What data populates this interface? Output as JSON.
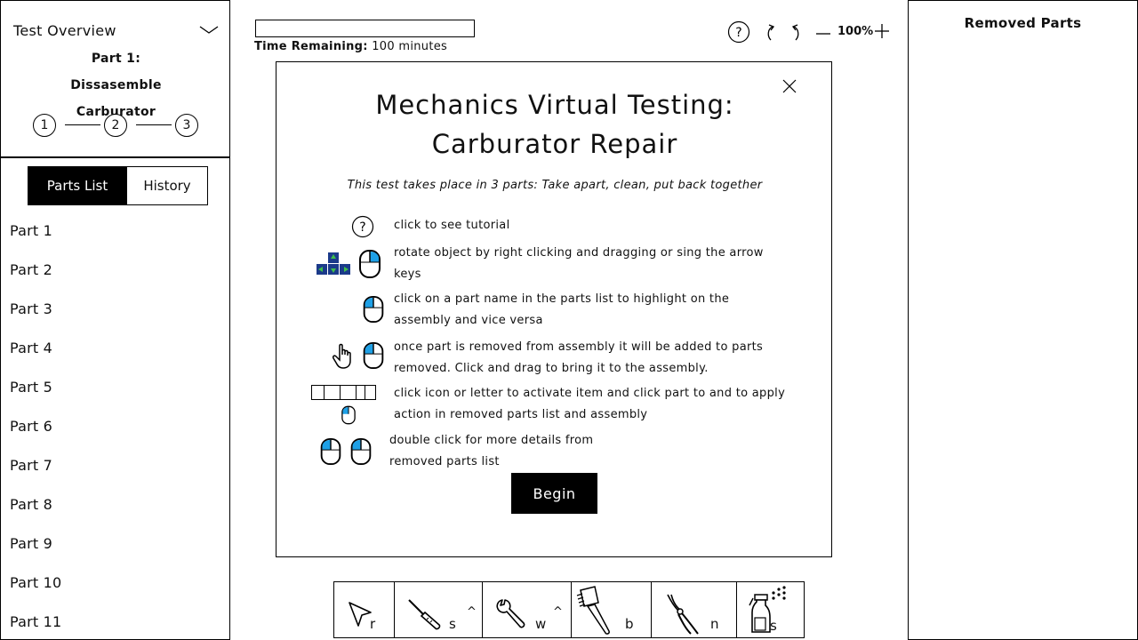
{
  "left_panel": {
    "overview_title": "Test Overview",
    "part_title": "Part 1: Dissasemble Carburator",
    "steps": [
      "1",
      "2",
      "3"
    ],
    "tabs": {
      "parts_list": "Parts List",
      "history": "History"
    },
    "parts": [
      "Part 1",
      "Part 2",
      "Part 3",
      "Part 4",
      "Part 5",
      "Part 6",
      "Part 7",
      "Part 8",
      "Part 9",
      "Part 10",
      "Part 11"
    ]
  },
  "header": {
    "time_label": "Time Remaining:",
    "time_value": "100 minutes",
    "zoom": "100%"
  },
  "right_panel": {
    "title": "Removed Parts"
  },
  "modal": {
    "title": "Mechanics Virtual Testing: Carburator Repair",
    "subtitle": "This test takes place in 3 parts: Take apart, clean, put back together",
    "instructions": [
      "click to see tutorial",
      "rotate object by right clicking and dragging or sing the arrow keys",
      "click on a part name in the parts list to highlight on the assembly and vice versa",
      "once part is removed from assembly it will be added to parts removed. Click and drag to bring it to the assembly.",
      "click icon or letter to activate item and click part to and to apply action in removed parts list and assembly",
      "double click for more details from removed parts list"
    ],
    "begin_label": "Begin"
  },
  "tools": [
    {
      "icon": "pointer-icon",
      "key": "r",
      "caret": ""
    },
    {
      "icon": "screwdriver-icon",
      "key": "s",
      "caret": "^"
    },
    {
      "icon": "wrench-icon",
      "key": "w",
      "caret": "^"
    },
    {
      "icon": "brush-icon",
      "key": "b",
      "caret": ""
    },
    {
      "icon": "pliers-icon",
      "key": "n",
      "caret": ""
    },
    {
      "icon": "spray-bottle-icon",
      "key": "s",
      "caret": ""
    }
  ],
  "colors": {
    "accent_blue": "#1ea0e6",
    "key_navy": "#1b3a8a",
    "key_green": "#3fbf4a"
  }
}
